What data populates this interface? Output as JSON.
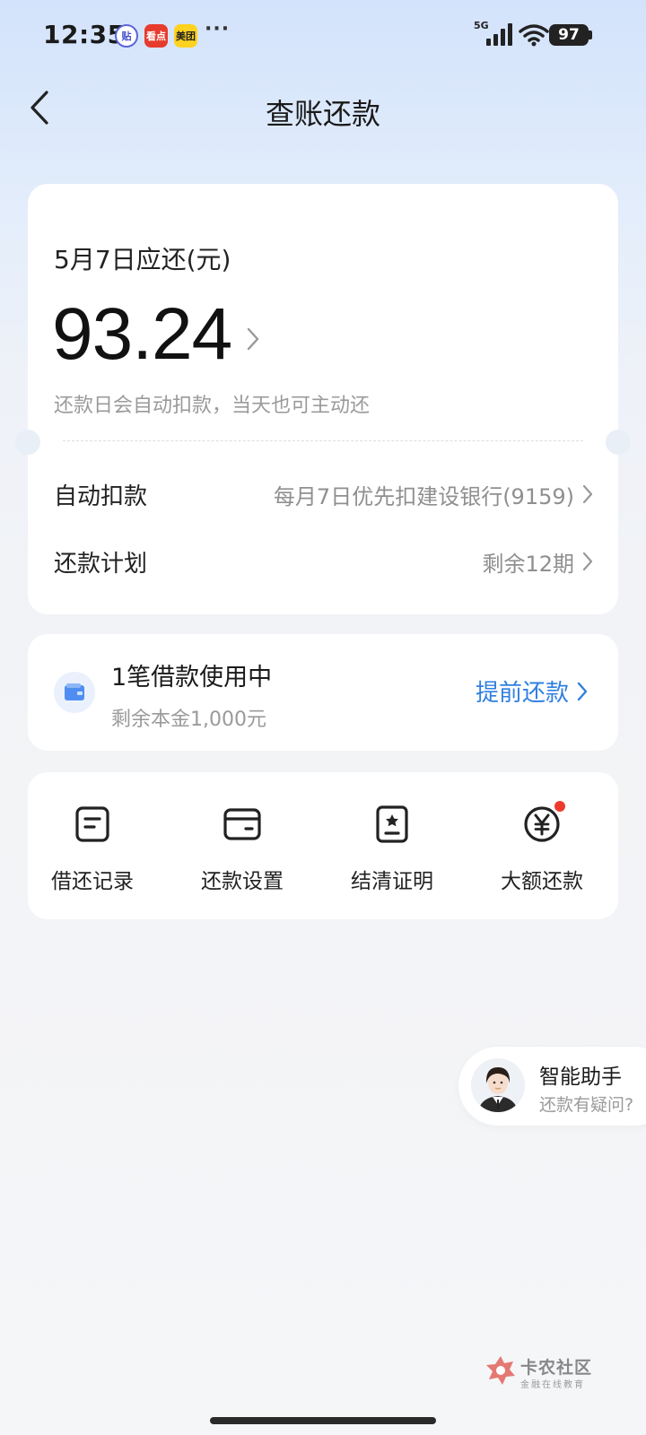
{
  "status_bar": {
    "time": "12:35",
    "notifications": [
      "贴",
      "看点",
      "美团"
    ],
    "more": "···",
    "network": "5G",
    "battery": "97"
  },
  "header": {
    "title": "查账还款"
  },
  "bill": {
    "due_label": "5月7日应还(元)",
    "amount": "93.24",
    "hint": "还款日会自动扣款，当天也可主动还"
  },
  "rows": {
    "autopay_label": "自动扣款",
    "autopay_value": "每月7日优先扣建设银行(9159)",
    "plan_label": "还款计划",
    "plan_value": "剩余12期"
  },
  "loan": {
    "title": "1笔借款使用中",
    "subtitle": "剩余本金1,000元",
    "action": "提前还款"
  },
  "menu": {
    "items": [
      {
        "label": "借还记录",
        "icon": "record-icon"
      },
      {
        "label": "还款设置",
        "icon": "wallet-settings-icon"
      },
      {
        "label": "结清证明",
        "icon": "certificate-icon"
      },
      {
        "label": "大额还款",
        "icon": "yuan-icon"
      }
    ]
  },
  "assistant": {
    "title": "智能助手",
    "subtitle": "还款有疑问?"
  },
  "watermark": {
    "title": "卡农社区",
    "subtitle": "金融在线教育"
  },
  "colors": {
    "accent": "#2f7fe0",
    "badge_red": "#ee3a2e"
  }
}
